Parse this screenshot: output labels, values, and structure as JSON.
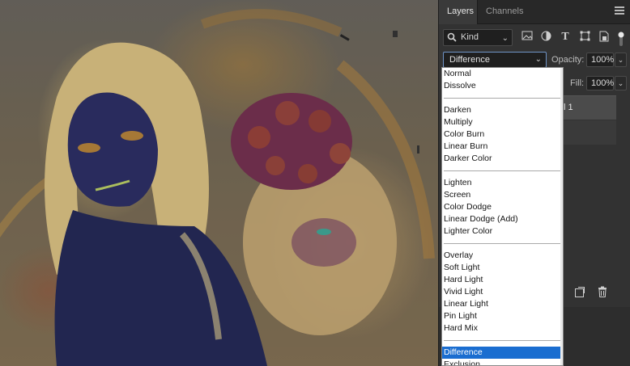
{
  "panel": {
    "tabs": [
      {
        "label": "Layers",
        "active": true
      },
      {
        "label": "Channels",
        "active": false
      }
    ],
    "filter": {
      "kind_label": "Kind",
      "icons": [
        "image-filter-icon",
        "adjustment-filter-icon",
        "type-filter-icon",
        "shape-filter-icon",
        "smart-object-filter-icon",
        "filter-toggle-icon"
      ]
    },
    "blend_mode": {
      "value": "Difference",
      "opacity_label": "Opacity:",
      "opacity_value": "100%"
    },
    "fill": {
      "label": "Fill:",
      "value": "100%"
    },
    "layer_partial_name": "l 1",
    "bottom_icons": [
      "new-layer-icon",
      "trash-icon"
    ]
  },
  "dropdown": {
    "groups": [
      [
        "Normal",
        "Dissolve"
      ],
      [
        "Darken",
        "Multiply",
        "Color Burn",
        "Linear Burn",
        "Darker Color"
      ],
      [
        "Lighten",
        "Screen",
        "Color Dodge",
        "Linear Dodge (Add)",
        "Lighter Color"
      ],
      [
        "Overlay",
        "Soft Light",
        "Hard Light",
        "Vivid Light",
        "Linear Light",
        "Pin Light",
        "Hard Mix"
      ],
      [
        "Difference",
        "Exclusion"
      ]
    ],
    "selected": "Difference"
  },
  "colors": {
    "panel_bg": "#323232",
    "selected_bg": "#1a6dd0",
    "dropdown_bg": "#ffffff"
  }
}
